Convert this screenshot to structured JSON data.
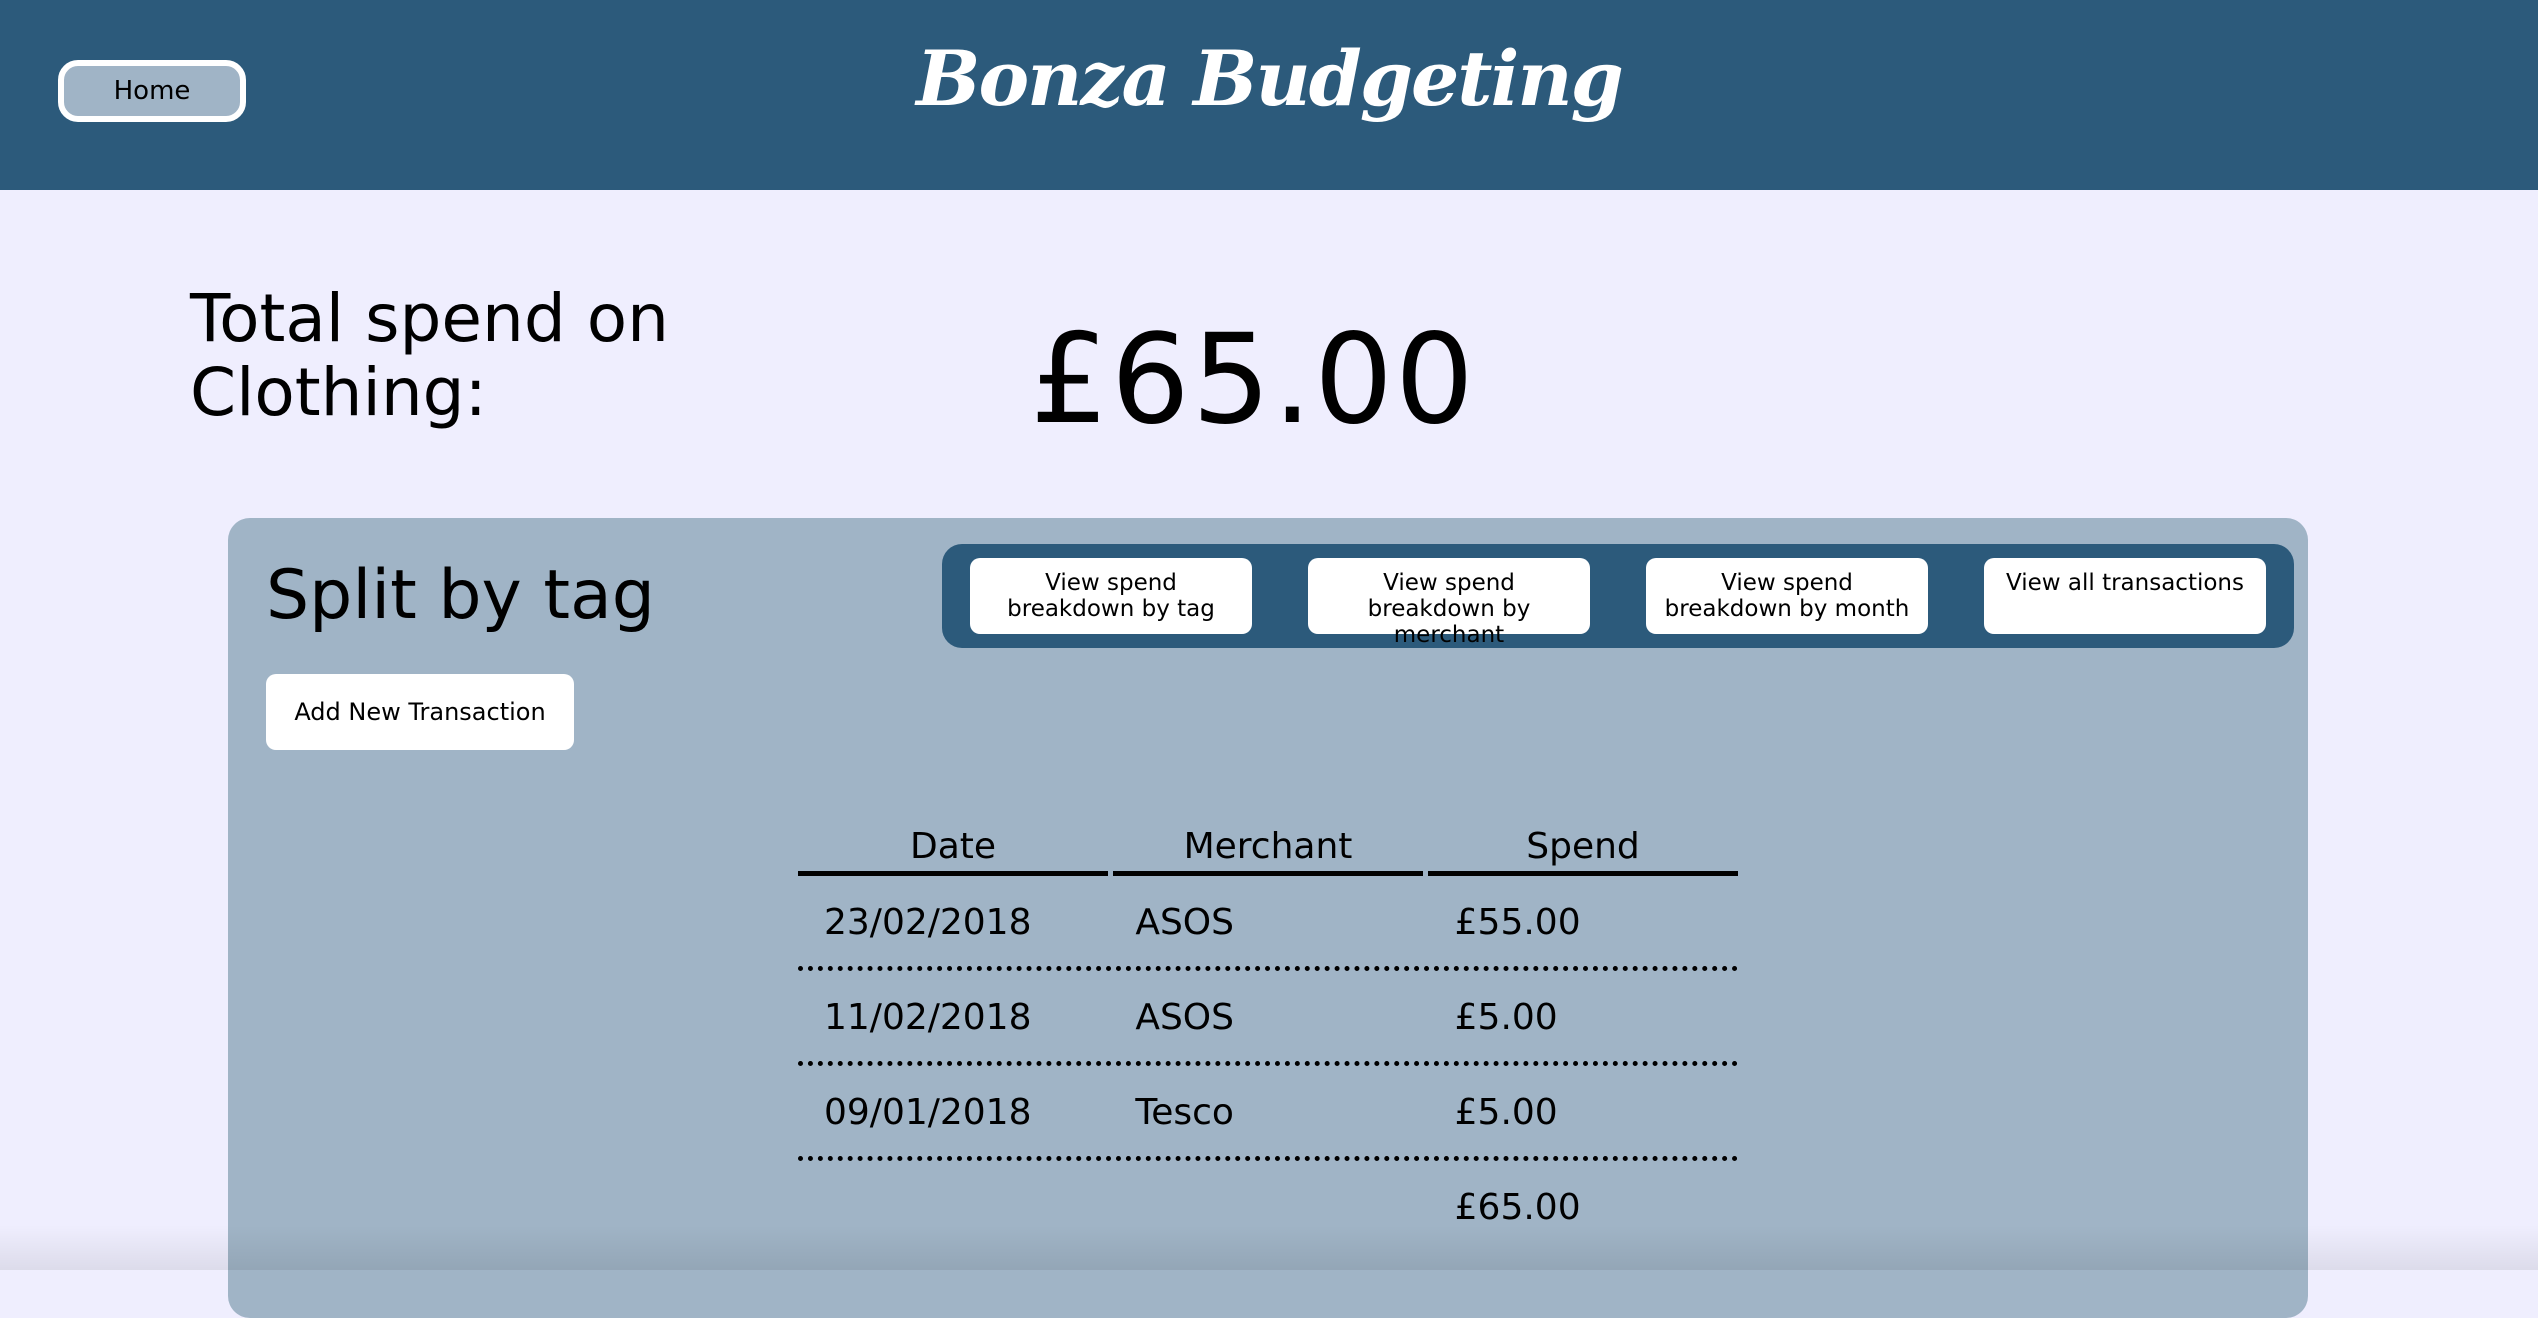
{
  "header": {
    "home_label": "Home",
    "title": "Bonza Budgeting"
  },
  "summary": {
    "label": "Total spend on Clothing:",
    "value": "£65.00"
  },
  "panel": {
    "title": "Split by tag",
    "add_button": "Add New Transaction",
    "nav": [
      {
        "label": "View spend breakdown by tag"
      },
      {
        "label": "View spend breakdown by merchant"
      },
      {
        "label": "View spend breakdown by month"
      },
      {
        "label": "View all transactions"
      }
    ]
  },
  "table": {
    "headers": [
      "Date",
      "Merchant",
      "Spend"
    ],
    "rows": [
      {
        "date": "23/02/2018",
        "merchant": "ASOS",
        "spend": "£55.00"
      },
      {
        "date": "11/02/2018",
        "merchant": "ASOS",
        "spend": "£5.00"
      },
      {
        "date": "09/01/2018",
        "merchant": "Tesco",
        "spend": "£5.00"
      }
    ],
    "total": "£65.00"
  },
  "colors": {
    "header_bg": "#2c5a7b",
    "page_bg": "#efeefe",
    "panel_bg": "#a0b4c6"
  }
}
